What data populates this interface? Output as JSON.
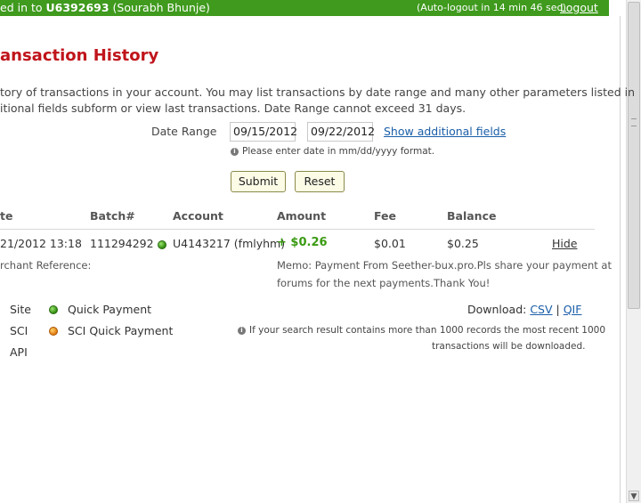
{
  "topbar": {
    "login_prefix": "ed in to ",
    "account_id": "U6392693",
    "user_name": " (Sourabh Bhunje)",
    "autologout": "(Auto-logout in 14 min 46 sec)",
    "logout": "Logout"
  },
  "page": {
    "title": "ansaction History",
    "description_line1": "tory of transactions in your account. You may list transactions by date range and many other parameters listed in",
    "description_line2": "itional fields subform or view last transactions. Date Range cannot exceed 31 days."
  },
  "filter": {
    "date_range_label": "Date Range",
    "date_from": "09/15/2012",
    "date_to": "09/22/2012",
    "show_additional": "Show additional fields",
    "date_format_note": "Please enter date in mm/dd/yyyy format.",
    "submit": "Submit",
    "reset": "Reset"
  },
  "table": {
    "headers": [
      "te",
      "Batch#",
      "Account",
      "Amount",
      "Fee",
      "Balance"
    ],
    "rows": [
      {
        "date": "21/2012 13:18",
        "batch": "111294292",
        "account": "U4143217 (fmlyhm)",
        "amount": "+ $0.26",
        "fee": "$0.01",
        "balance": "$0.25",
        "action": "Hide",
        "merchant_reference": "rchant Reference:",
        "memo_line1": "Memo: Payment From Seether-bux.pro.Pls share your payment at",
        "memo_line2": "forums for the next payments.Thank You!"
      }
    ]
  },
  "legend": {
    "items": [
      {
        "code": "Site",
        "label": "Quick Payment",
        "color": "#2f8a10"
      },
      {
        "code": "SCI",
        "label": "SCI Quick Payment",
        "color": "#e07a10"
      },
      {
        "code": "API",
        "label": ""
      }
    ]
  },
  "download": {
    "label": "Download: ",
    "csv": "CSV",
    "separator": " | ",
    "qif": "QIF",
    "note_line1": "If your search result contains more than 1000 records the most recent 1000",
    "note_line2": "transactions will be downloaded."
  },
  "colors": {
    "topbar": "#3f9a1d",
    "title": "#c0141b",
    "amount": "#3a9a12",
    "link": "#1a5ea8"
  }
}
